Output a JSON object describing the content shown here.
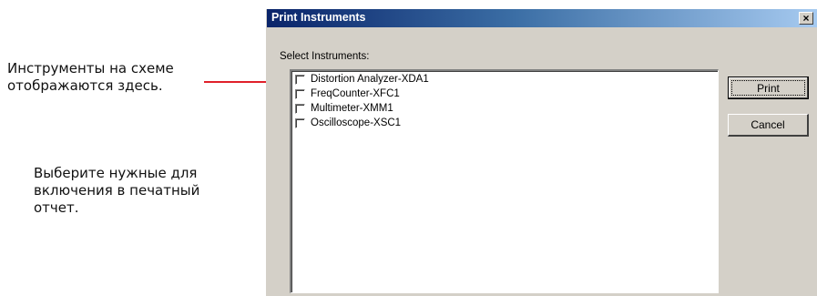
{
  "annotations": {
    "instruments_shown": "Инструменты на схеме отображаются здесь.",
    "select_for_report": "Выберите нужные для включения в печатный отчет."
  },
  "dialog": {
    "title": "Print Instruments",
    "close_glyph": "✕",
    "list_label": "Select Instruments:",
    "items": [
      {
        "label": "Distortion Analyzer-XDA1",
        "checked": false
      },
      {
        "label": "FreqCounter-XFC1",
        "checked": false
      },
      {
        "label": "Multimeter-XMM1",
        "checked": false
      },
      {
        "label": "Oscilloscope-XSC1",
        "checked": false
      }
    ],
    "buttons": {
      "print": "Print",
      "cancel": "Cancel"
    }
  },
  "colors": {
    "title_gradient_start": "#0a246a",
    "title_gradient_end": "#a6caf0",
    "dialog_face": "#d4d0c8",
    "pointer_line": "#e0202a"
  }
}
